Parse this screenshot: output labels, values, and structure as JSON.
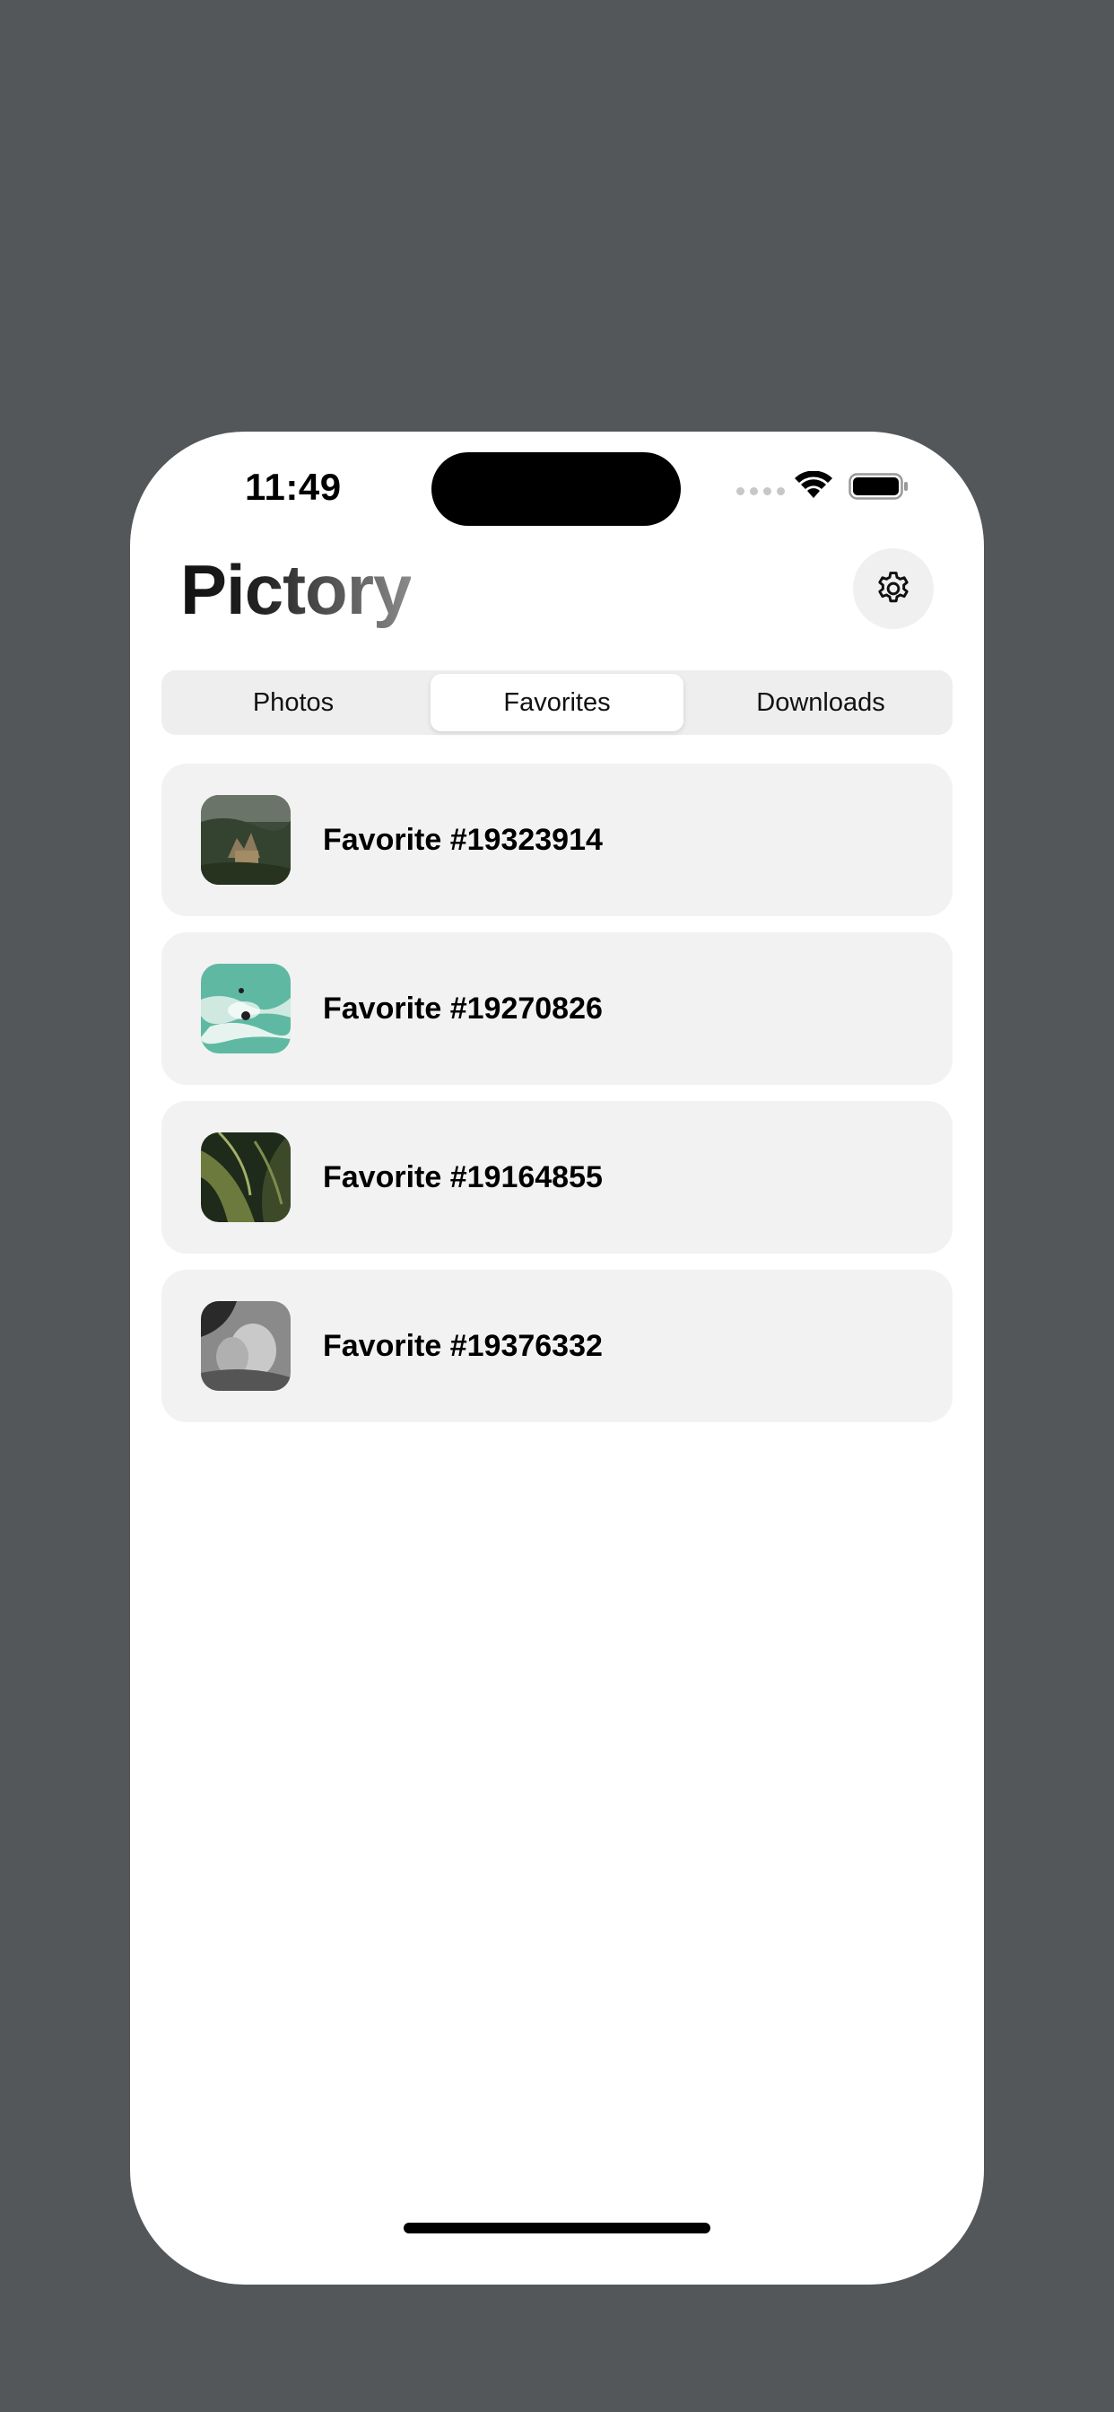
{
  "status_bar": {
    "time": "11:49"
  },
  "header": {
    "title": "Pictory",
    "settings_icon": "gear-icon"
  },
  "tabs": [
    {
      "label": "Photos",
      "selected": false
    },
    {
      "label": "Favorites",
      "selected": true
    },
    {
      "label": "Downloads",
      "selected": false
    }
  ],
  "favorites": [
    {
      "label": "Favorite #19323914",
      "thumbnail": "castle-landscape-photo"
    },
    {
      "label": "Favorite #19270826",
      "thumbnail": "turquoise-water-swimmer-photo"
    },
    {
      "label": "Favorite #19164855",
      "thumbnail": "green-palm-leaves-photo"
    },
    {
      "label": "Favorite #19376332",
      "thumbnail": "black-white-portrait-photo"
    }
  ],
  "colors": {
    "background": "#53575a",
    "screen": "#ffffff",
    "card": "#f2f2f2",
    "segment_track": "#eeeeef"
  }
}
